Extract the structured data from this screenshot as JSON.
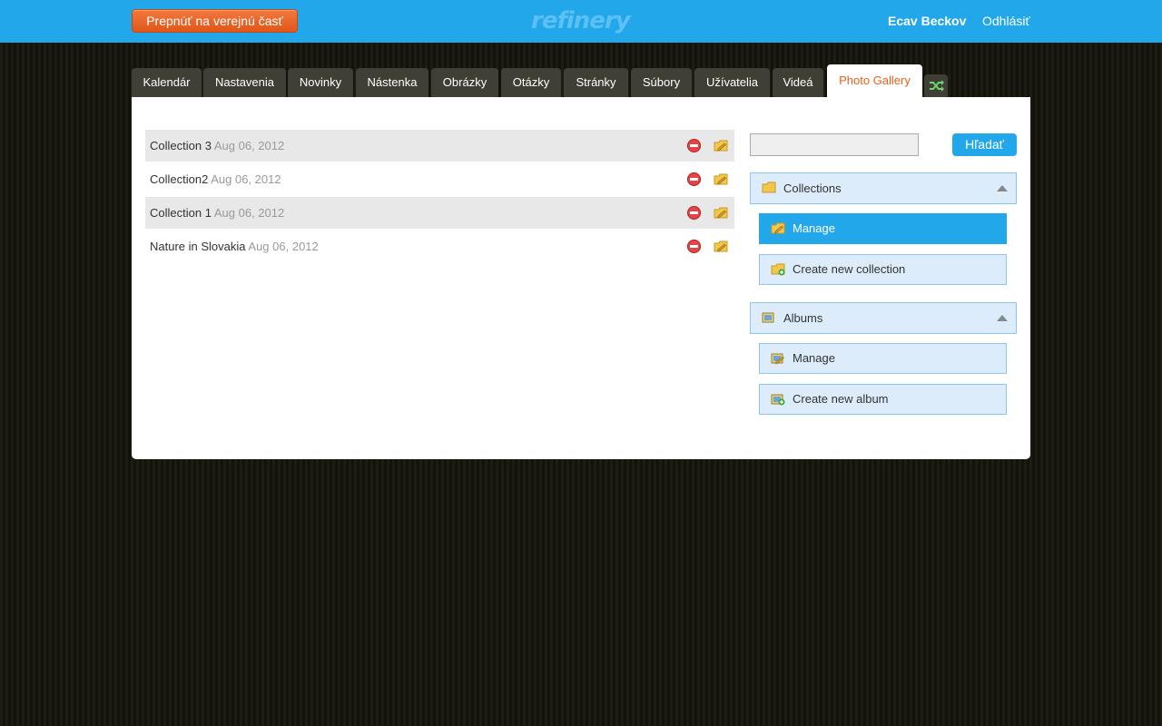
{
  "header": {
    "switch_label": "Prepnúť na verejnú časť",
    "logo": "refinery",
    "user_name": "Ecav Beckov",
    "logout_label": "Odhlásiť"
  },
  "tabs": [
    {
      "label": "Kalendár"
    },
    {
      "label": "Nastavenia"
    },
    {
      "label": "Novinky"
    },
    {
      "label": "Nástenka"
    },
    {
      "label": "Obrázky"
    },
    {
      "label": "Otázky"
    },
    {
      "label": "Stránky"
    },
    {
      "label": "Súbory"
    },
    {
      "label": "Užívatelia"
    },
    {
      "label": "Videá"
    },
    {
      "label": "Photo Gallery",
      "active": true
    }
  ],
  "tab_icon": "shuffle-icon",
  "collections": [
    {
      "name": "Collection 3",
      "date": "Aug 06, 2012"
    },
    {
      "name": "Collection2",
      "date": "Aug 06, 2012"
    },
    {
      "name": "Collection 1",
      "date": "Aug 06, 2012"
    },
    {
      "name": "Nature in Slovakia",
      "date": "Aug 06, 2012"
    }
  ],
  "sidebar": {
    "search_value": "",
    "search_button": "Hľadať",
    "collections_heading": "Collections",
    "collections_manage": "Manage",
    "collections_create": "Create new collection",
    "albums_heading": "Albums",
    "albums_manage": "Manage",
    "albums_create": "Create new album"
  },
  "colors": {
    "accent": "#22a7ea",
    "switch_button": "#e8601c",
    "active_tab_text": "#e8601c",
    "delete": "#e34545"
  }
}
